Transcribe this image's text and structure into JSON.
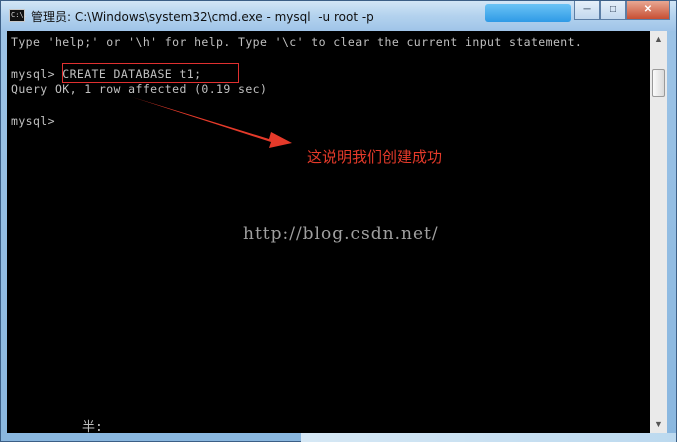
{
  "window": {
    "title": "管理员: C:\\Windows\\system32\\cmd.exe - mysql  -u root -p",
    "icon_text": "C:\\.",
    "ad_text": "",
    "min_label": "─",
    "max_label": "□",
    "close_label": "✕"
  },
  "console": {
    "lines": [
      "Type 'help;' or '\\h' for help. Type '\\c' to clear the current input statement.",
      "",
      "mysql> CREATE DATABASE t1;",
      "Query OK, 1 row affected (0.19 sec)",
      "",
      "mysql>"
    ],
    "ime_status": "半:"
  },
  "annotation": {
    "text": "这说明我们创建成功",
    "color": "#e53a2a"
  },
  "watermark": "http://blog.csdn.net/",
  "colors": {
    "console_bg": "#000000",
    "console_text": "#c0c0c0",
    "highlight_box": "#e03030"
  },
  "scrollbar": {
    "up_icon": "▲",
    "down_icon": "▼"
  }
}
